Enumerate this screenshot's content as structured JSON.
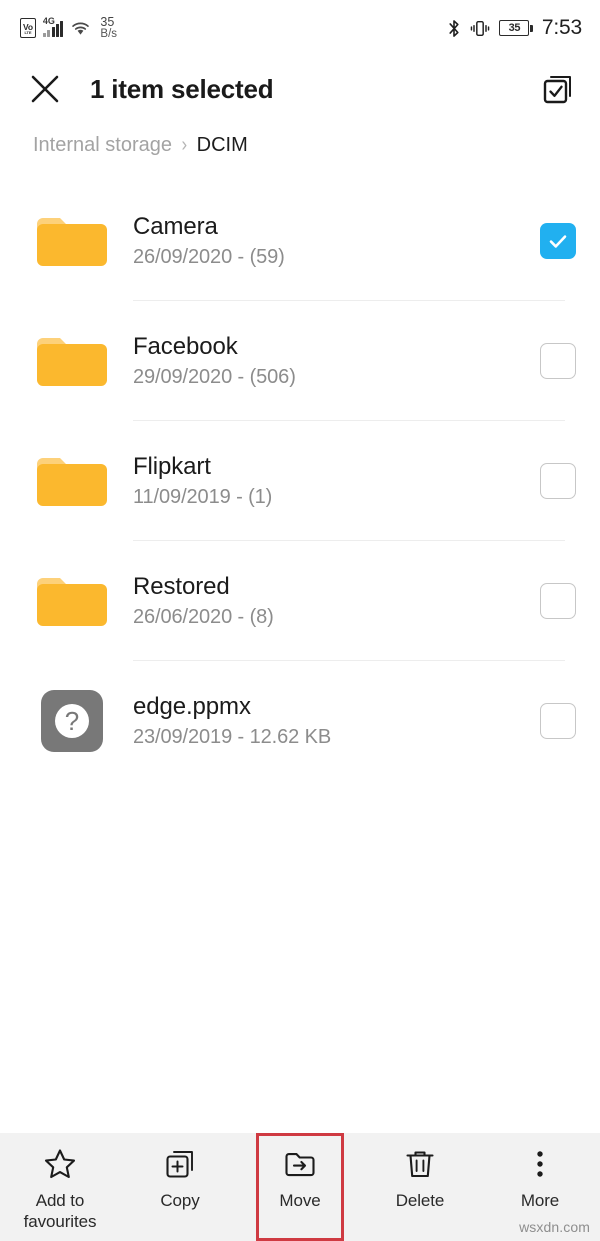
{
  "status_bar": {
    "volte_top": "Vo",
    "volte_bottom": "LTE",
    "network_gen": "4G",
    "speed_value": "35",
    "speed_unit": "B/s",
    "battery_level": "35",
    "time": "7:53",
    "icons": {
      "signal": "signal-bars-icon",
      "wifi": "wifi-icon",
      "bluetooth": "bluetooth-icon",
      "vibrate": "vibrate-icon",
      "battery": "battery-icon"
    }
  },
  "header": {
    "close_label": "close-icon",
    "title": "1 item selected",
    "select_all_label": "select-all-icon"
  },
  "breadcrumb": {
    "root": "Internal storage",
    "separator": "›",
    "current": "DCIM"
  },
  "file_list": [
    {
      "name": "Camera",
      "meta": "26/09/2020 - (59)",
      "icon": "folder-icon",
      "selected": true
    },
    {
      "name": "Facebook",
      "meta": "29/09/2020 - (506)",
      "icon": "folder-icon",
      "selected": false
    },
    {
      "name": "Flipkart",
      "meta": "11/09/2019 - (1)",
      "icon": "folder-icon",
      "selected": false
    },
    {
      "name": "Restored",
      "meta": "26/06/2020 - (8)",
      "icon": "folder-icon",
      "selected": false
    },
    {
      "name": "edge.ppmx",
      "meta": "23/09/2019 - 12.62 KB",
      "icon": "unknown-file-icon",
      "selected": false
    }
  ],
  "toolbar": [
    {
      "label": "Add to\nfavourites",
      "label_line1": "Add to",
      "label_line2": "favourites",
      "icon": "star-icon",
      "highlighted": false
    },
    {
      "label": "Copy",
      "icon": "copy-icon",
      "highlighted": false
    },
    {
      "label": "Move",
      "icon": "move-folder-icon",
      "highlighted": true
    },
    {
      "label": "Delete",
      "icon": "trash-icon",
      "highlighted": false
    },
    {
      "label": "More",
      "icon": "more-vertical-icon",
      "highlighted": false
    }
  ],
  "watermark": "wsxdn.com",
  "colors": {
    "folder": "#fbb82e",
    "folder_tab": "#fdd17a",
    "checkbox_selected": "#21b0f0",
    "unknown_file": "#787878",
    "highlight_box": "#cf3a42",
    "toolbar_bg": "#f2f2f2"
  }
}
